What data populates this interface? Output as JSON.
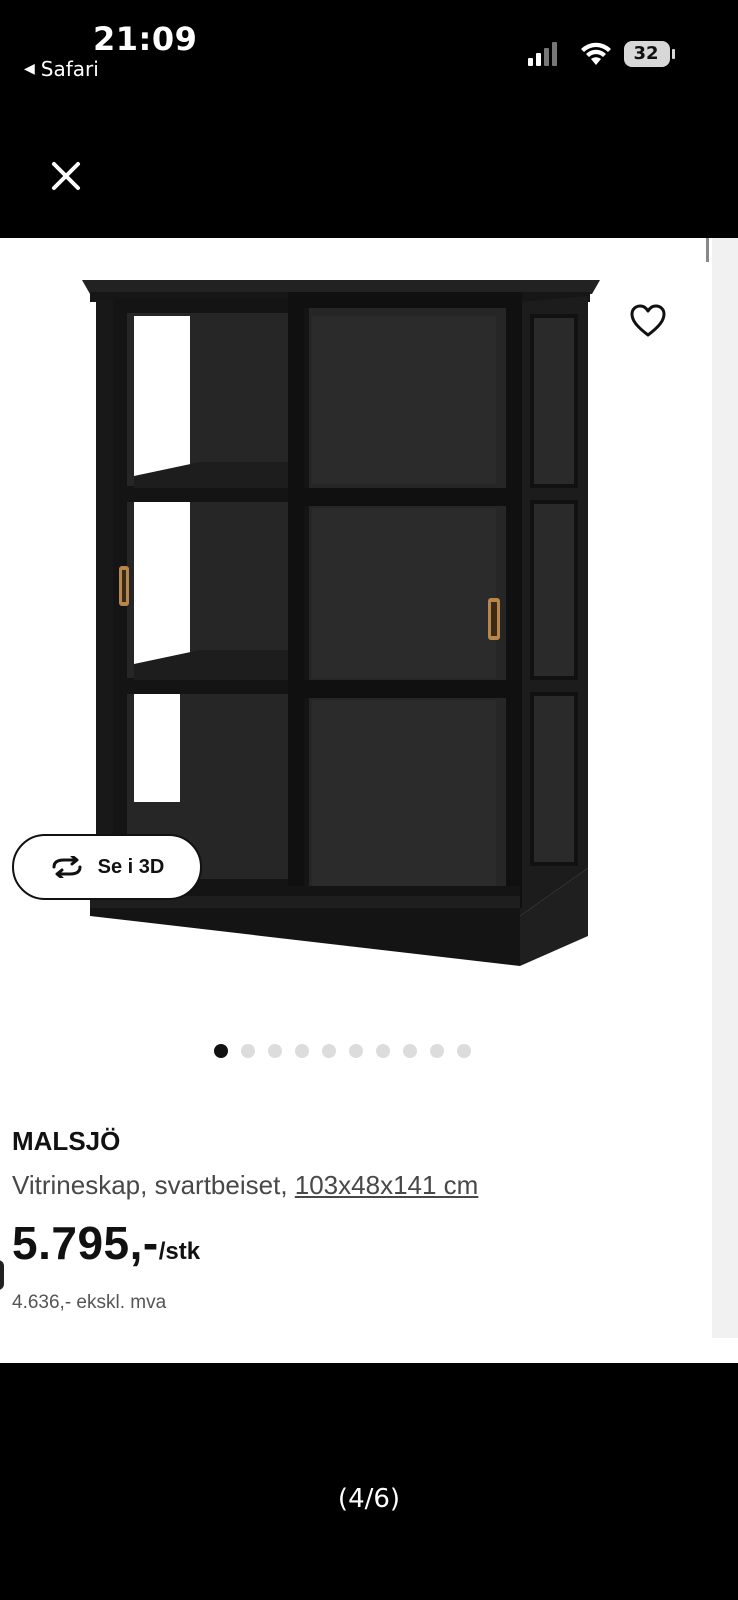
{
  "status_bar": {
    "time": "21:09",
    "back_app": "Safari",
    "battery": "32"
  },
  "icons": {
    "close": "close-icon",
    "favorite": "heart-icon",
    "rotate": "rotate-3d-icon"
  },
  "product": {
    "view_3d_label": "Se i 3D",
    "carousel": {
      "total": 10,
      "active_index": 0
    },
    "name": "MALSJÖ",
    "description": "Vitrineskap, svartbeiset, ",
    "dimensions": "103x48x141 cm",
    "price": "5.795,-",
    "price_unit": "/stk",
    "price_ex_vat": "4.636,- ekskl. mva"
  },
  "viewer": {
    "page_indicator": "(4/6)"
  },
  "colors": {
    "background": "#000000",
    "panel": "#ffffff",
    "cabinet": "#1a1a1a",
    "handle": "#b8864a"
  }
}
